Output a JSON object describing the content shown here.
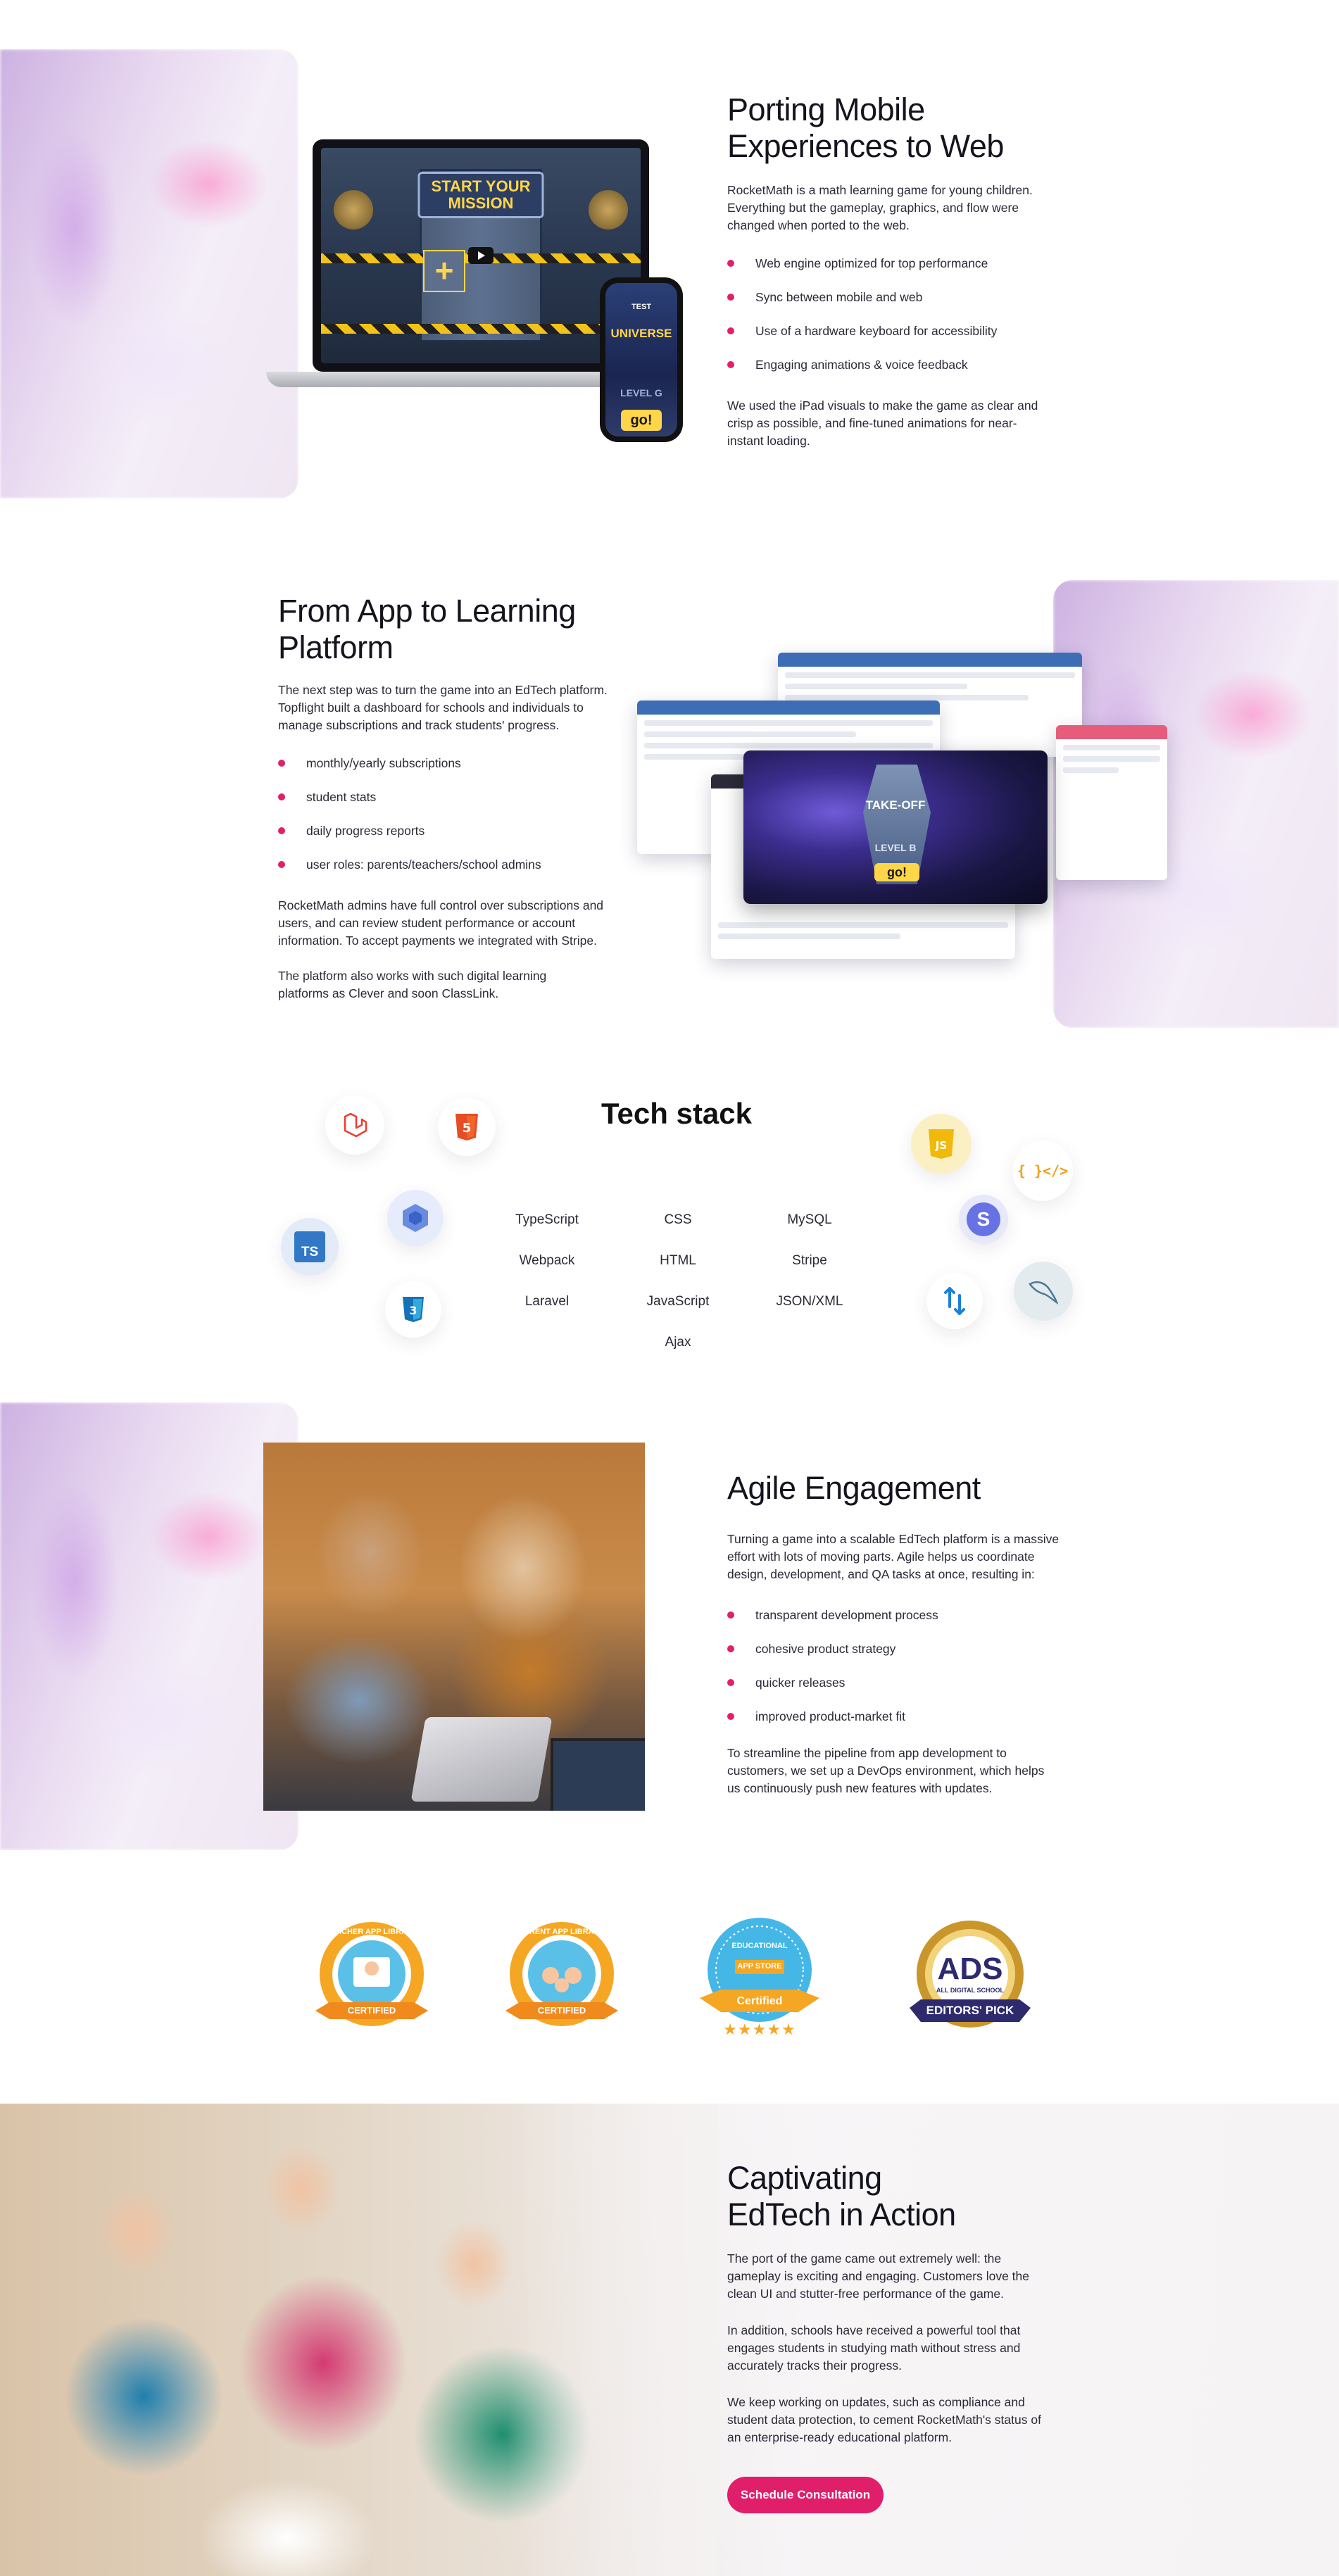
{
  "porting": {
    "title_line1": "Porting Mobile",
    "title_line2": "Experiences to Web",
    "intro": "RocketMath is a math learning game for young children. Everything but the gameplay, graphics, and flow were changed when ported to the web.",
    "bullets": [
      "Web engine optimized for top performance",
      "Sync between mobile and web",
      "Use of a hardware keyboard for accessibility",
      "Engaging animations & voice feedback"
    ],
    "outro": "We used the iPad visuals to make the game as clear and crisp as possible, and fine-tuned animations for near-instant loading.",
    "game": {
      "banner_line1": "START YOUR",
      "banner_line2": "MISSION",
      "phone_test": "TEST",
      "phone_universe": "UNIVERSE",
      "phone_level": "LEVEL G",
      "phone_go": "go!"
    }
  },
  "platform": {
    "title_line1": "From App to Learning",
    "title_line2": "Platform",
    "intro": "The next step was to turn the game into an EdTech platform. Topflight built a dashboard for schools and individuals to manage subscriptions and track students' progress.",
    "bullets": [
      "monthly/yearly subscriptions",
      "student stats",
      "daily progress reports",
      "user roles: parents/teachers/school admins"
    ],
    "para1": "RocketMath admins have full control over subscriptions and users, and can review student performance or account information. To accept payments we integrated with Stripe.",
    "para2": "The platform also works with such digital learning platforms as Clever and soon ClassLink.",
    "game": {
      "takeoff": "TAKE-OFF",
      "level": "LEVEL B",
      "go": "go!"
    }
  },
  "tech": {
    "title": "Tech stack",
    "col1": [
      "TypeScript",
      "Webpack",
      "Laravel"
    ],
    "col2": [
      "CSS",
      "HTML",
      "JavaScript",
      "Ajax"
    ],
    "col3": [
      "MySQL",
      "Stripe",
      "JSON/XML"
    ],
    "icons": {
      "laravel": "laravel-icon",
      "html5": "html5-icon",
      "ts": "TS",
      "node": "nodejs-icon",
      "css3": "css3-icon",
      "js": "JS",
      "code": "{ }</>",
      "stripe": "S",
      "mysql": "mysql-icon",
      "transfer": "transfer-icon"
    }
  },
  "agile": {
    "title": "Agile Engagement",
    "intro": "Turning a game into a scalable EdTech platform is a massive effort with lots of moving parts. Agile helps us coordinate design, development, and QA tasks at once, resulting in:",
    "bullets": [
      "transparent development process",
      "cohesive product strategy",
      "quicker releases",
      "improved product-market fit"
    ],
    "outro": "To streamline the pipeline from app development to customers, we set up a DevOps environment, which helps us continuously push new features with updates."
  },
  "badges": {
    "teacher_top": "TEACHER APP LIBRARY",
    "teacher_bottom": "CERTIFIED",
    "parent_top": "PARENT APP LIBRARY",
    "parent_bottom": "CERTIFIED",
    "edu_top": "EDUCATIONAL",
    "edu_mid": "APP STORE",
    "edu_bottom": "Certified",
    "edu_stars": "★★★★★",
    "ads_big": "ADS",
    "ads_sub": "ALL DIGITAL SCHOOL",
    "ads_ribbon": "EDITORS' PICK"
  },
  "action": {
    "title_line1": "Captivating",
    "title_line2": "EdTech in Action",
    "para1": "The port of the game came out extremely well: the gameplay is exciting and engaging. Customers love the clean UI and stutter-free performance of the game.",
    "para2": "In addition, schools have received a powerful tool that engages students in studying math without stress and accurately tracks their progress.",
    "para3": "We keep working on updates, such as compliance and student data protection, to cement RocketMath's status of an enterprise-ready educational platform.",
    "cta": "Schedule Consultation"
  },
  "colors": {
    "accent": "#e01e6a",
    "heading": "#14141f"
  }
}
